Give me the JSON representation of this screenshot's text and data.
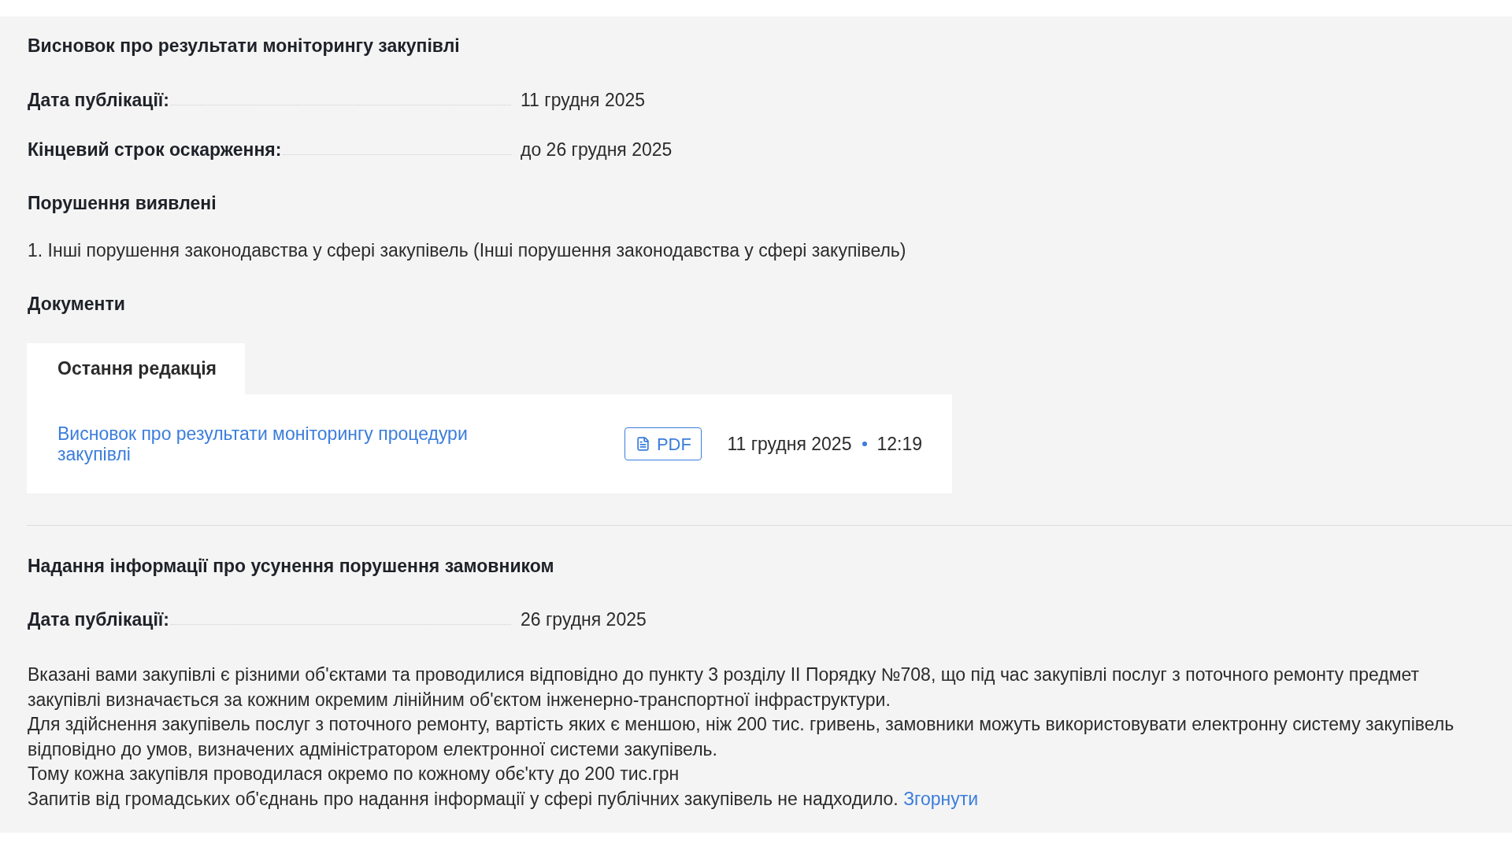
{
  "conclusion": {
    "title": "Висновок про результати моніторингу закупівлі",
    "fields": [
      {
        "label": "Дата публікації:",
        "value": "11 грудня 2025"
      },
      {
        "label": "Кінцевий строк оскарження:",
        "value": "до 26 грудня 2025"
      }
    ],
    "violations": {
      "title": "Порушення виявлені",
      "items": [
        "1. Інші порушення законодавства у сфері закупівель (Інші порушення законодавства у сфері закупівель)"
      ]
    },
    "documents": {
      "title": "Документи",
      "tabs": [
        {
          "label": "Остання редакція",
          "selected": true
        }
      ],
      "files": [
        {
          "name": "Висновок про результати моніторингу процедури закупівлі",
          "format": "PDF",
          "date": "11 грудня 2025",
          "time": "12:19"
        }
      ]
    }
  },
  "elimination_report": {
    "title": "Надання інформації про усунення порушення замовником",
    "fields": [
      {
        "label": "Дата публікації:",
        "value": "26 грудня 2025"
      }
    ],
    "description": {
      "lines": [
        "Вказані вами закупівлі є різними об'єктами та проводилися відповідно до пункту 3 розділу II Порядку №708, що під час закупівлі послуг з поточного ремонту предмет закупівлі визначається за кожним окремим лінійним об'єктом інженерно-транспортної інфраструктури.",
        "Для здійснення закупівель послуг з поточного ремонту, вартість яких є меншою, ніж 200 тис. гривень, замовники можуть використовувати електронну систему закупівель відповідно до умов, визначених адміністратором електронної системи закупівель.",
        "Тому кожна закупівля проводилася окремо по кожному обє'кту до 200 тис.грн",
        "Запитів від громадських об'єднань про надання інформації у сфері публічних закупівель не надходило."
      ],
      "link": "Згорнути"
    }
  }
}
